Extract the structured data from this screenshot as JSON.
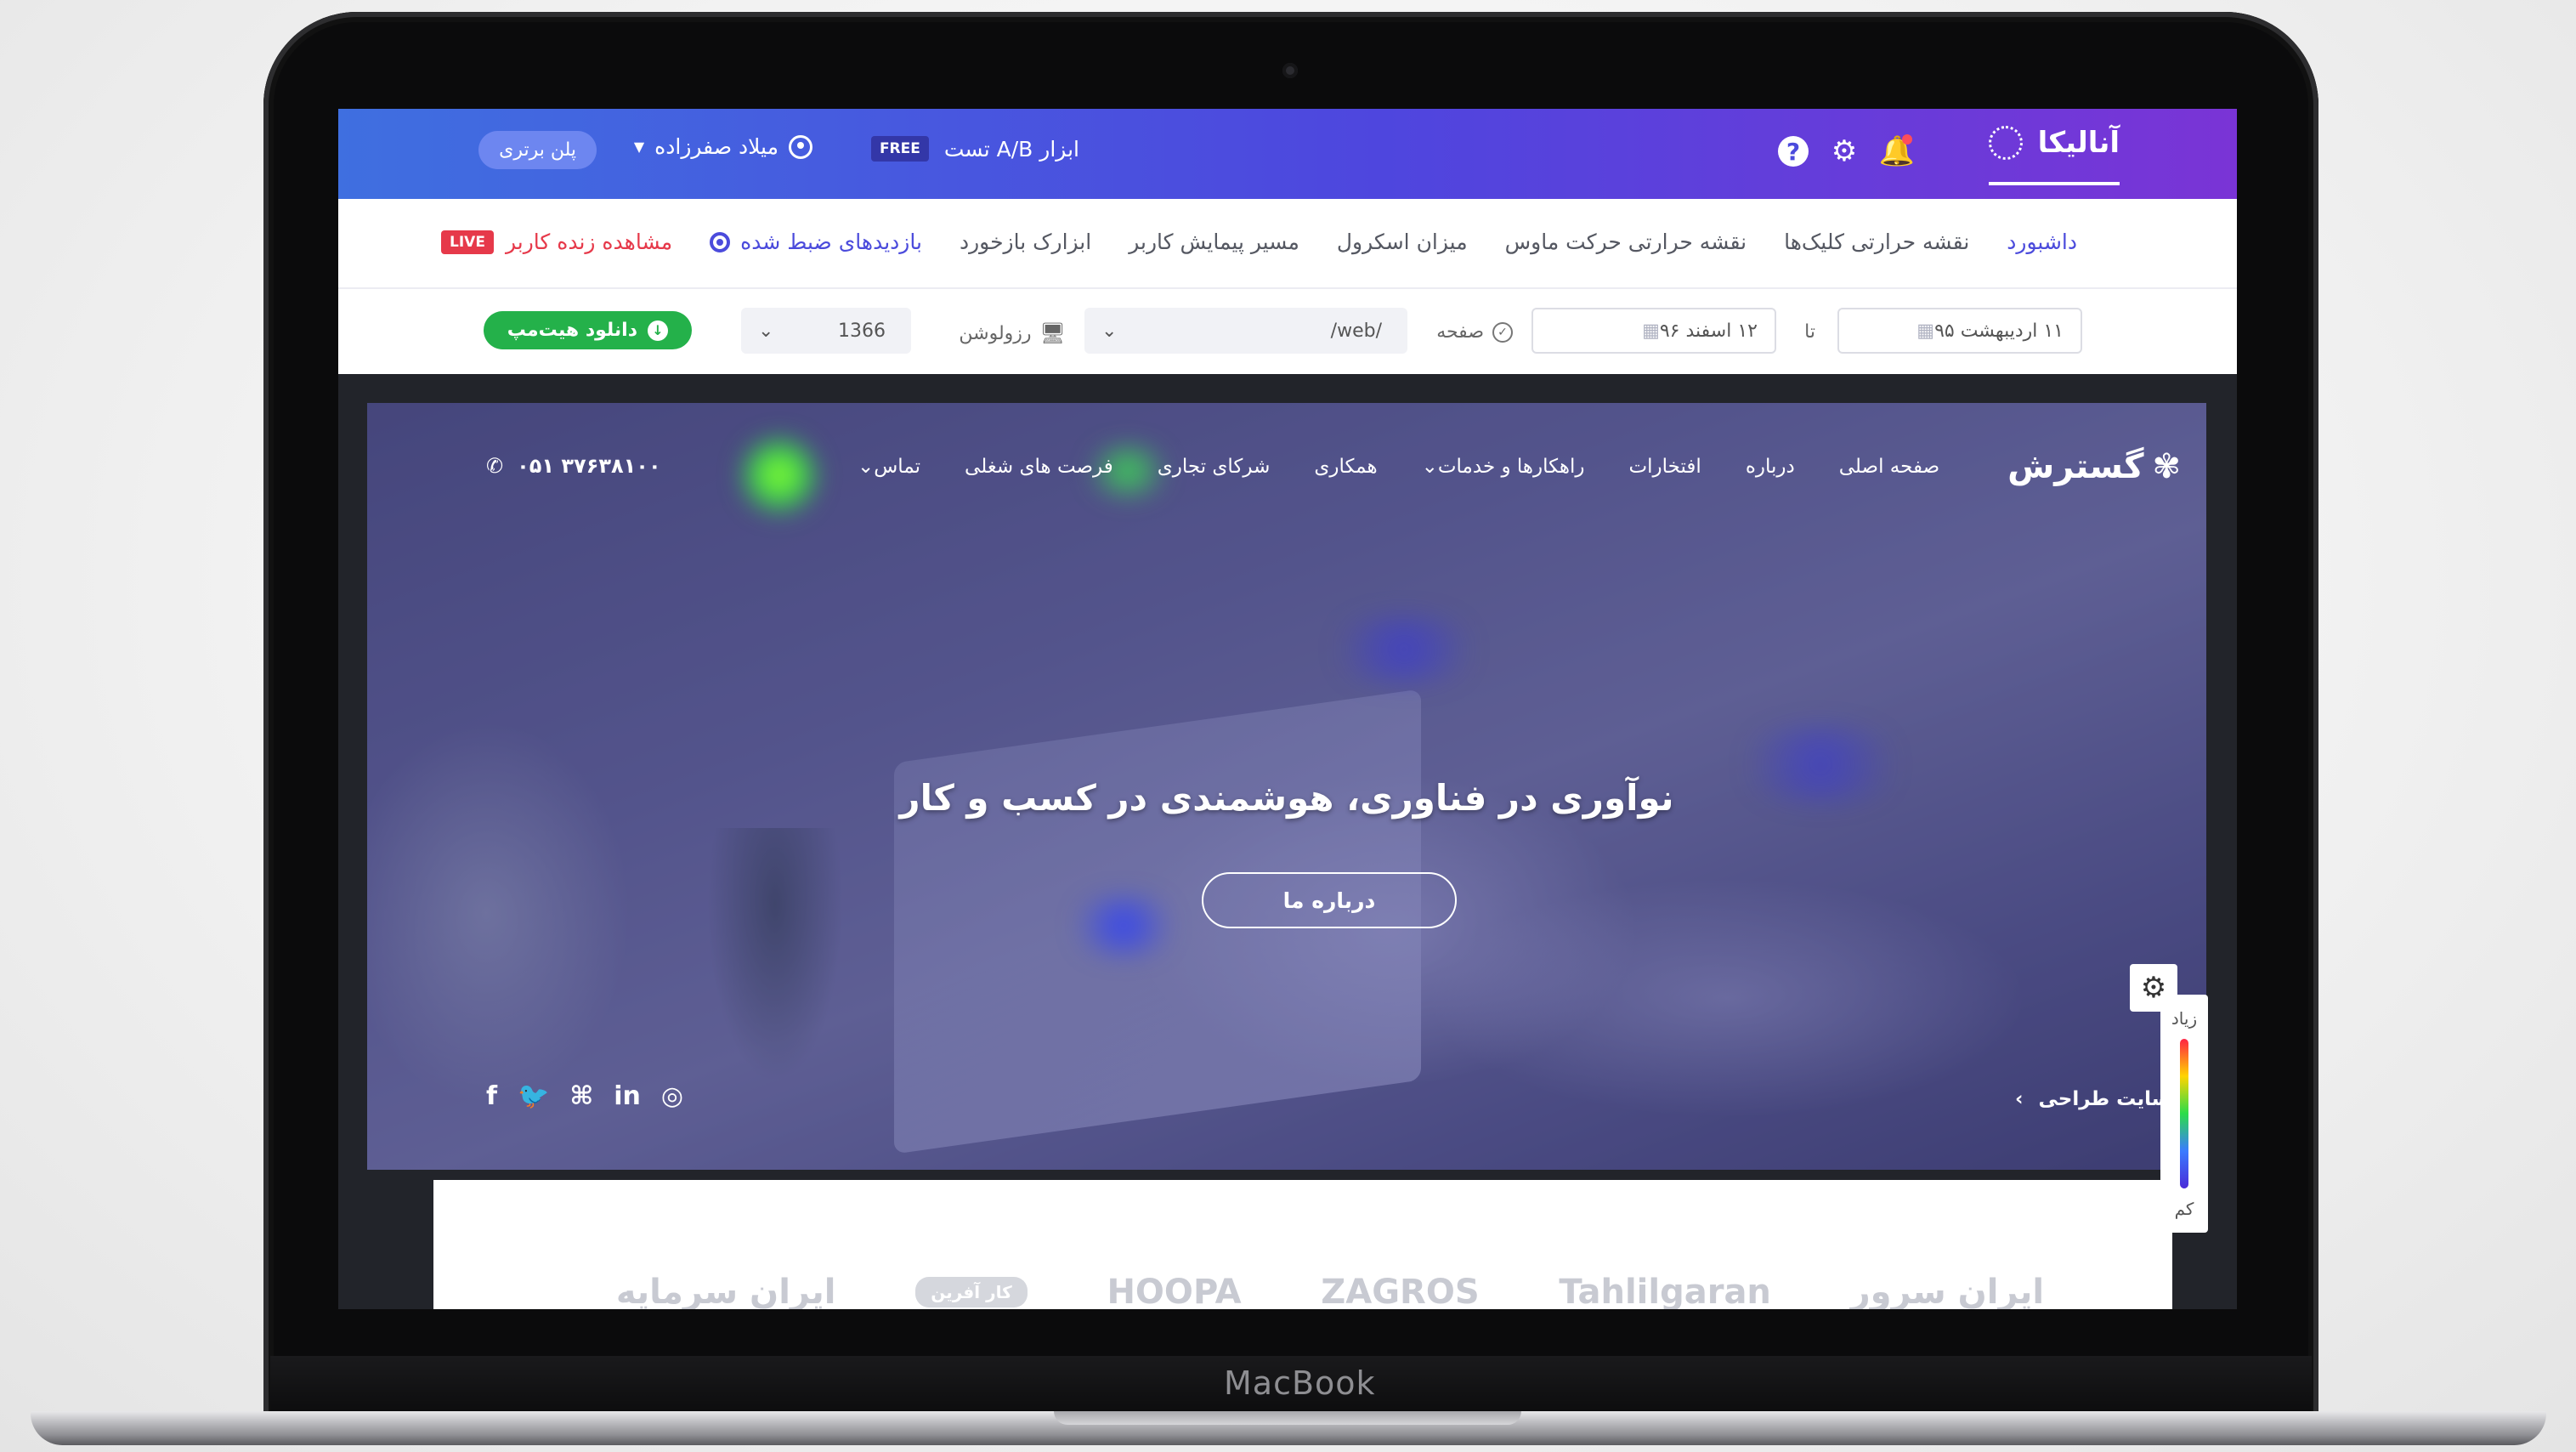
{
  "device": {
    "label": "MacBook"
  },
  "app": {
    "name": "آنالیکا",
    "ab_tool": "ابزار A/B تست",
    "free_badge": "FREE",
    "user_name": "میلاد صفرزاده",
    "plan_button": "پلن برتری",
    "icons": [
      "help-icon",
      "settings-icon",
      "notification-bell-icon"
    ]
  },
  "nav": {
    "items": [
      {
        "label": "داشبورد",
        "active": true
      },
      {
        "label": "نقشه حرارتی کلیک‌ها"
      },
      {
        "label": "نقشه حرارتی حرکت ماوس"
      },
      {
        "label": "میزان اسکرول"
      },
      {
        "label": "مسیر پیمایش کاربر"
      },
      {
        "label": "ابزارک بازخورد"
      },
      {
        "label": "بازدیدهای ضبط شده"
      },
      {
        "label": "مشاهده زنده کاربر"
      }
    ],
    "live_badge": "LIVE"
  },
  "filters": {
    "date_from": "۱۱ اردیبهشت ۹۵",
    "to_label": "تا",
    "date_to": "۱۲ اسفند ۹۶",
    "page_label": "صفحه",
    "page_value": "/web/",
    "resolution_label": "رزولوشن",
    "resolution_value": "1366",
    "download_button": "دانلود هیت‌مپ"
  },
  "site": {
    "logo": "گسترش",
    "links": [
      "صفحه اصلی",
      "درباره",
      "افتخارات",
      "راهکارها و خدمات",
      "همکاری",
      "شرکای تجاری",
      "فرصت های شغلی",
      "تماس"
    ],
    "phone": "۰۵۱ ۳۷۶۳۸۱۰۰",
    "hero_title": "نوآوری در فناوری، هوشمندی در کسب و کار",
    "hero_button": "درباره ما",
    "breadcrumb": "ه سایت طراحی",
    "socials": [
      "f",
      "🐦",
      "⌘",
      "in",
      "◎"
    ],
    "partners": [
      "ایران سرمایه",
      "کار آفرین",
      "HOOPA",
      "ZAGROS",
      "Tahlilgaran",
      "ایران سرور"
    ]
  },
  "legend": {
    "high": "زیاد",
    "low": "کم"
  },
  "colors": {
    "accent": "#4b4bdc",
    "header_start": "#3f6fe0",
    "header_end": "#7a34d6",
    "live": "#e6394a",
    "download": "#24b14a"
  }
}
